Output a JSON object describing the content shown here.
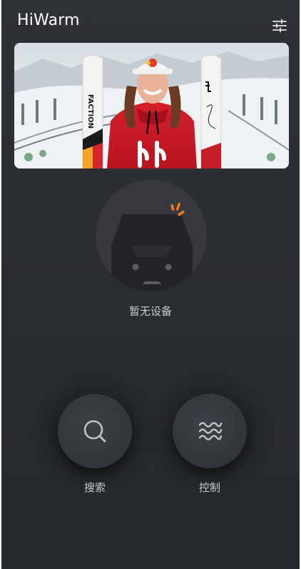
{
  "header": {
    "app_title": "HiWarm"
  },
  "icons": {
    "settings": "sliders-icon",
    "search": "search-icon",
    "control": "heat-waves-icon",
    "device": "heater-device-icon"
  },
  "device": {
    "status_text": "暂无设备"
  },
  "actions": {
    "search_label": "搜索",
    "control_label": "控制"
  },
  "banner": {
    "ski_brand_text": "FACTION"
  },
  "colors": {
    "background": "#2b2e32",
    "accent": "#f07b1c",
    "text": "#c9cbcd"
  }
}
